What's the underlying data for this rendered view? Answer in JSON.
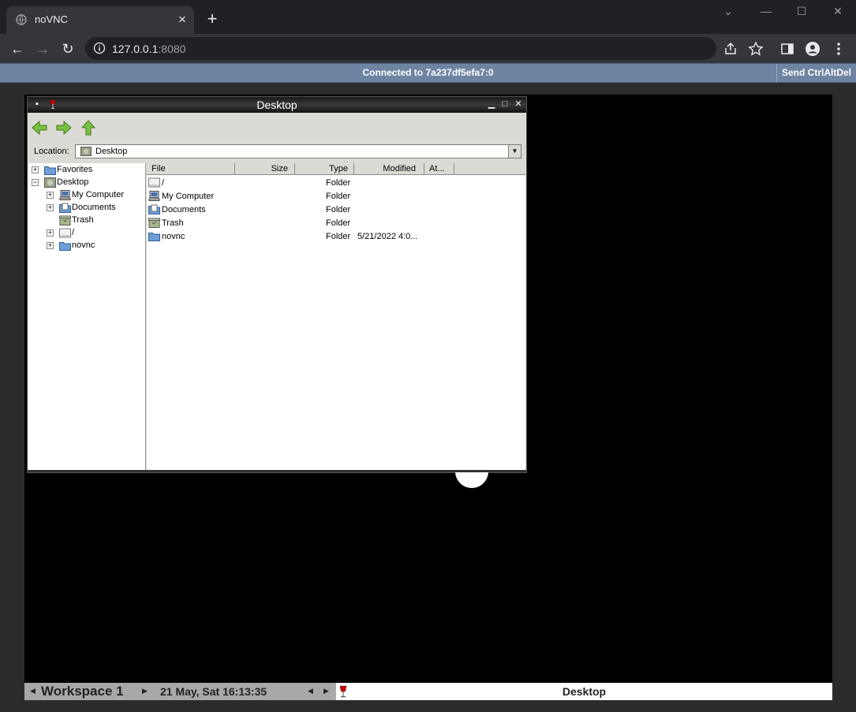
{
  "browser": {
    "tab_title": "noVNC",
    "url_host": "127.0.0.1",
    "url_port": ":8080"
  },
  "novnc": {
    "status": "Connected to 7a237df5efa7:0",
    "ctrl_alt_del": "Send CtrlAltDel"
  },
  "file_manager": {
    "title": "Desktop",
    "location_label": "Location:",
    "location_value": "Desktop",
    "tree": [
      {
        "label": "Favorites",
        "expander": "+"
      },
      {
        "label": "Desktop",
        "expander": "−"
      },
      {
        "label": "My Computer",
        "expander": "+"
      },
      {
        "label": "Documents",
        "expander": "+"
      },
      {
        "label": "Trash",
        "expander": ""
      },
      {
        "label": "/",
        "expander": "+"
      },
      {
        "label": "novnc",
        "expander": "+"
      }
    ],
    "columns": {
      "file": "File",
      "size": "Size",
      "type": "Type",
      "modified": "Modified",
      "attr": "At..."
    },
    "rows": [
      {
        "name": "/",
        "type": "Folder",
        "modified": ""
      },
      {
        "name": "My Computer",
        "type": "Folder",
        "modified": ""
      },
      {
        "name": "Documents",
        "type": "Folder",
        "modified": ""
      },
      {
        "name": "Trash",
        "type": "Folder",
        "modified": ""
      },
      {
        "name": "novnc",
        "type": "Folder",
        "modified": "5/21/2022 4:0..."
      }
    ]
  },
  "taskbar": {
    "workspace": "Workspace 1",
    "clock": "21 May, Sat 16:13:35",
    "task_title": "Desktop"
  }
}
